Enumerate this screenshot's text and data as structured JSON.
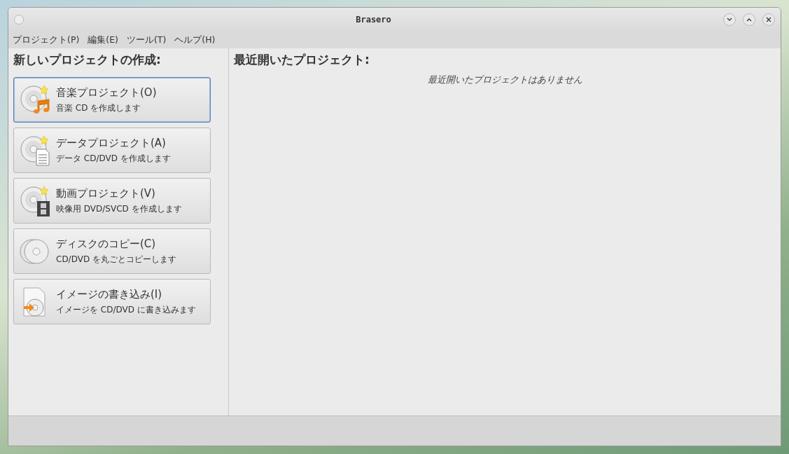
{
  "window": {
    "title": "Brasero"
  },
  "menu": [
    "プロジェクト(P)",
    "編集(E)",
    "ツール(T)",
    "ヘルプ(H)"
  ],
  "new_project": {
    "heading": "新しいプロジェクトの作成:",
    "items": [
      {
        "kind": "music",
        "title": "音楽プロジェクト(O)",
        "subtitle": "音楽 CD を作成します",
        "selected": true
      },
      {
        "kind": "data",
        "title": "データプロジェクト(A)",
        "subtitle": "データ CD/DVD を作成します",
        "selected": false
      },
      {
        "kind": "video",
        "title": "動画プロジェクト(V)",
        "subtitle": "映像用 DVD/SVCD を作成します",
        "selected": false
      },
      {
        "kind": "copy",
        "title": "ディスクのコピー(C)",
        "subtitle": "CD/DVD を丸ごとコピーします",
        "selected": false
      },
      {
        "kind": "image",
        "title": "イメージの書き込み(I)",
        "subtitle": "イメージを CD/DVD に書き込みます",
        "selected": false
      }
    ]
  },
  "recent": {
    "heading": "最近開いたプロジェクト:",
    "empty_message": "最近開いたプロジェクトはありません"
  }
}
